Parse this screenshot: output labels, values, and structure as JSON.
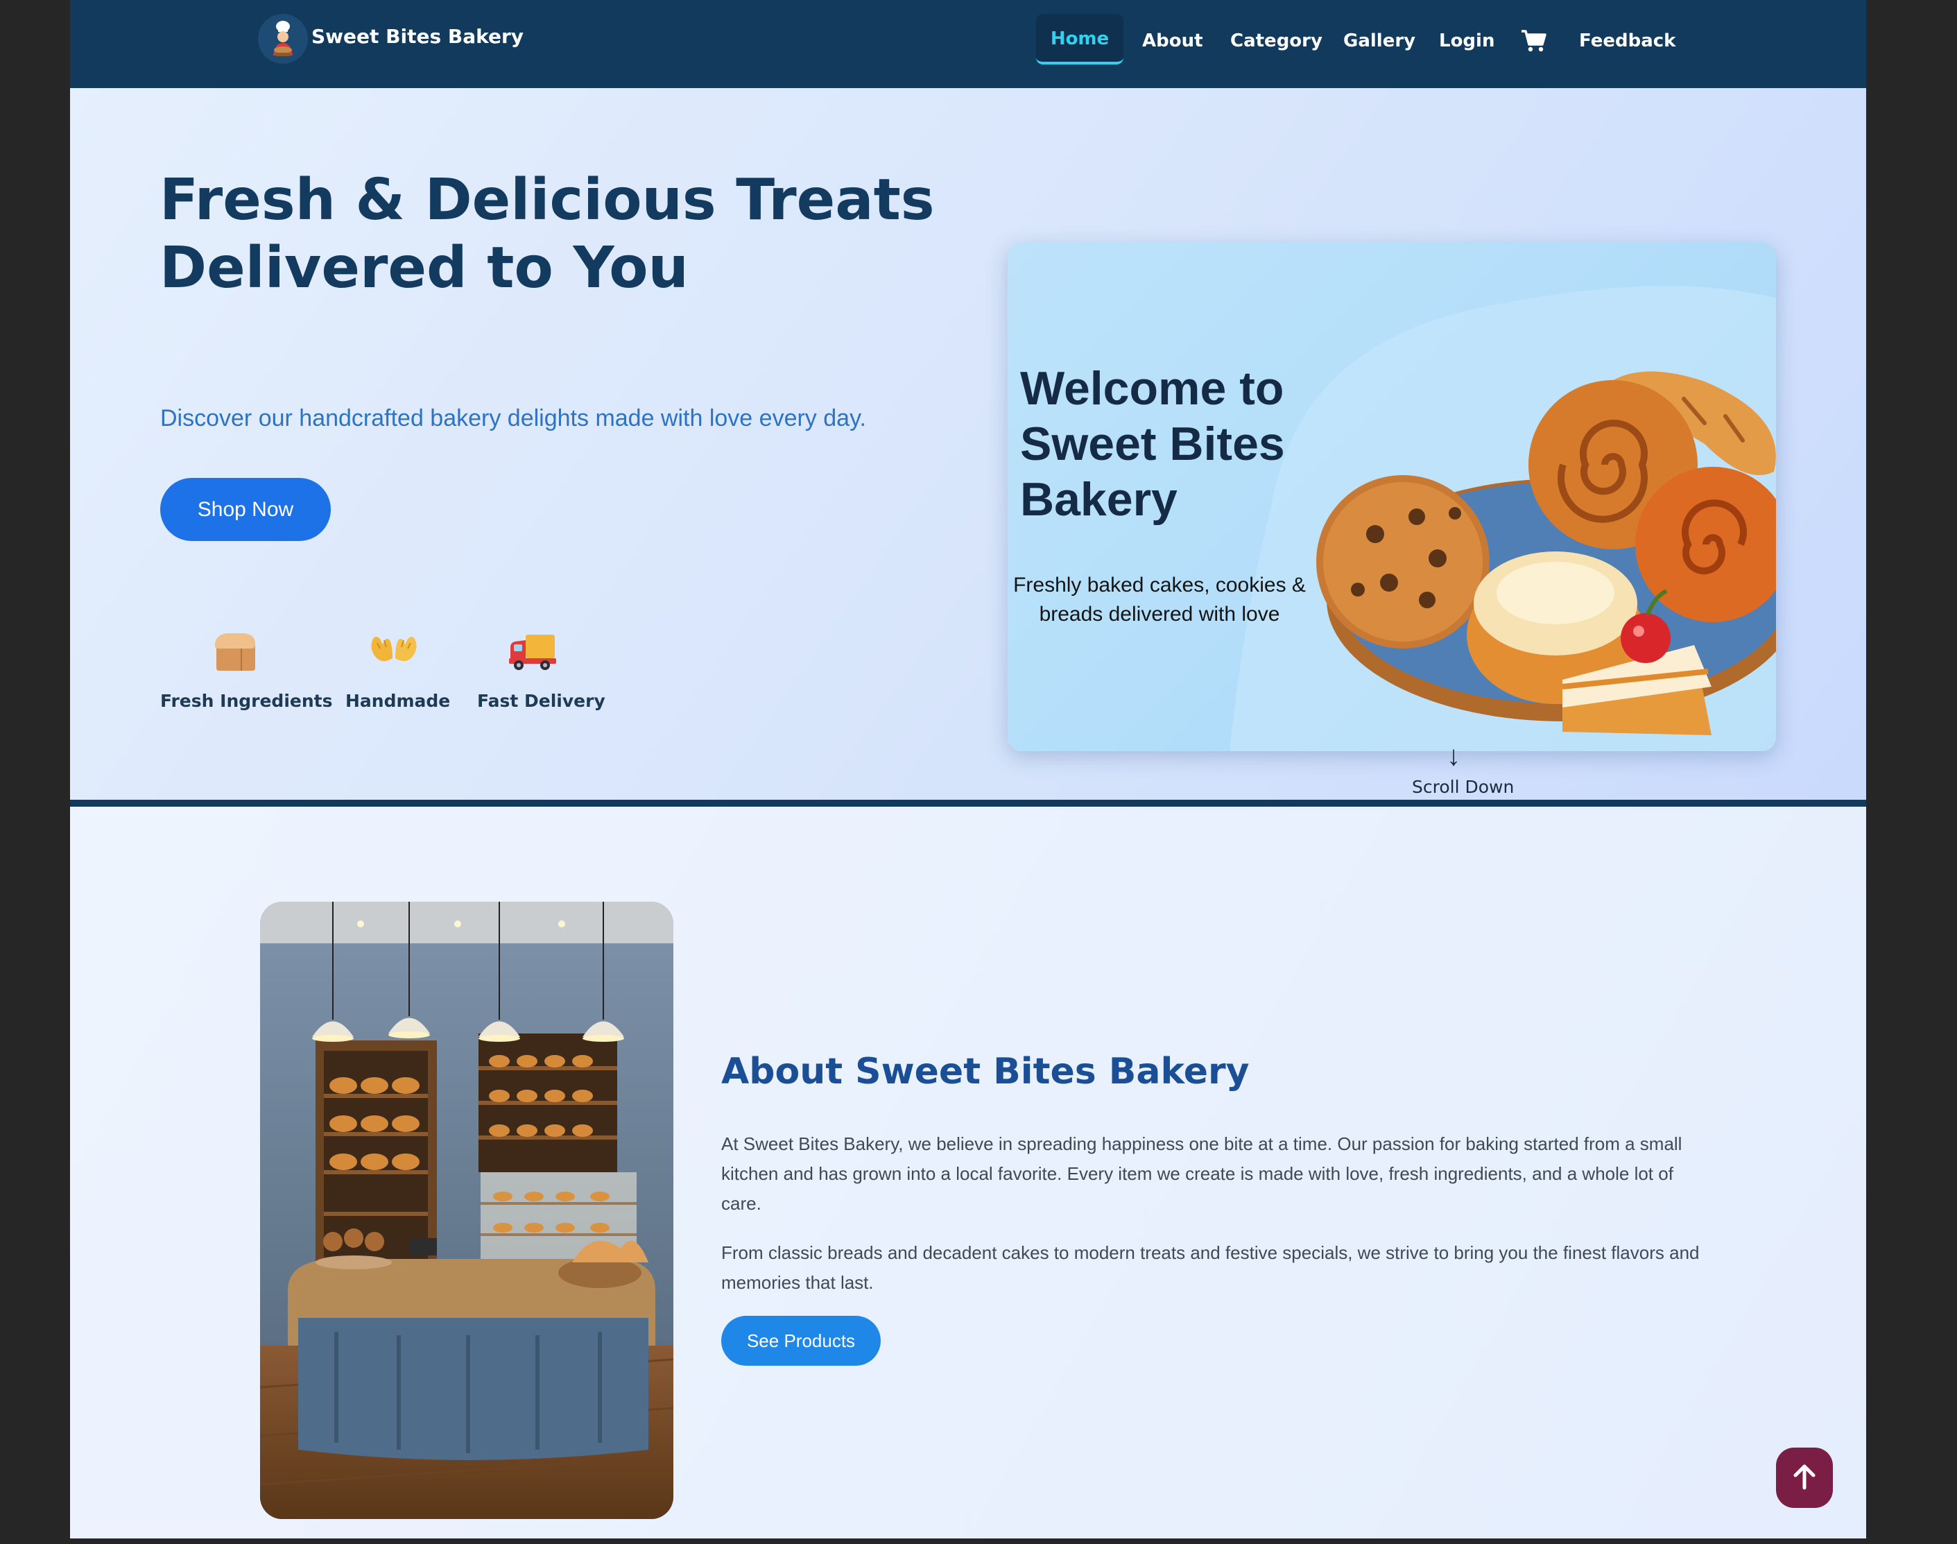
{
  "brand": {
    "name": "Sweet Bites Bakery",
    "logo_icon": "chef-logo-icon"
  },
  "nav": {
    "items": [
      {
        "label": "Home",
        "active": true
      },
      {
        "label": "About"
      },
      {
        "label": "Category"
      },
      {
        "label": "Gallery"
      },
      {
        "label": "Login"
      },
      {
        "label": "Feedback"
      }
    ],
    "cart_icon": "cart-icon"
  },
  "hero": {
    "title": "Fresh & Delicious Treats Delivered to You",
    "subtitle": "Discover our handcrafted bakery delights made with love every day.",
    "cta_label": "Shop Now",
    "features": [
      {
        "label": "Fresh Ingredients",
        "icon": "bread-icon"
      },
      {
        "label": "Handmade",
        "icon": "hands-icon"
      },
      {
        "label": "Fast Delivery",
        "icon": "truck-icon"
      }
    ],
    "card": {
      "title": "Welcome to Sweet Bites Bakery",
      "text": "Freshly baked cakes, cookies & breads delivered with love"
    },
    "scroll": {
      "arrow": "↓",
      "label": "Scroll Down"
    }
  },
  "about": {
    "title": "About Sweet Bites Bakery",
    "paragraphs": [
      "At Sweet Bites Bakery, we believe in spreading happiness one bite at a time. Our passion for baking started from a small kitchen and has grown into a local favorite. Every item we create is made with love, fresh ingredients, and a whole lot of care.",
      "From classic breads and decadent cakes to modern treats and festive specials, we strive to bring you the finest flavors and memories that last."
    ],
    "cta_label": "See Products"
  },
  "colors": {
    "navbar": "#113a5d",
    "active_nav": "#2fd3ef",
    "primary_button": "#1d72e8",
    "heading": "#133a5f",
    "back_to_top": "#7b1e46"
  }
}
